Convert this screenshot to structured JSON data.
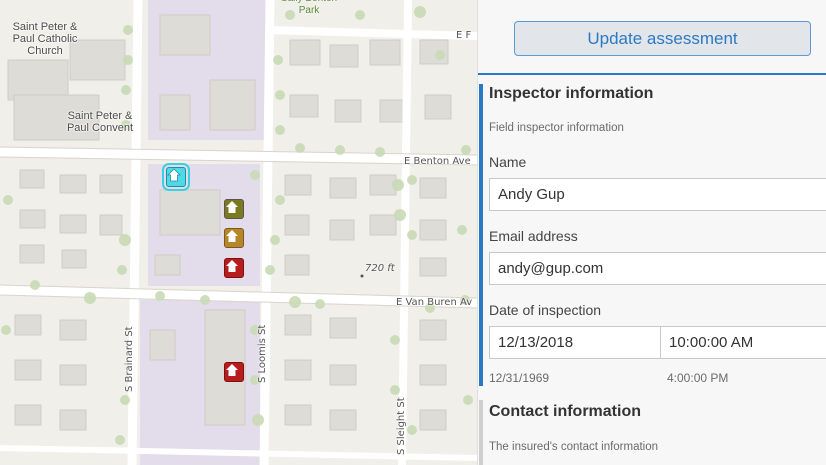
{
  "map": {
    "streets": {
      "e_f": "E F",
      "benton": "E Benton Ave",
      "van_buren": "E Van Buren Av",
      "brainard": "S Brainard St",
      "loomis": "S Loomis St",
      "sleight": "S Sleight St"
    },
    "pois": {
      "church": "Saint Peter & Paul Catholic Church",
      "convent": "Saint Peter & Paul Convent",
      "park": "Sally Benton Park"
    },
    "elevation": "720 ft",
    "markers": [
      {
        "name": "selected-assessment",
        "fill": "#4fd9e8"
      },
      {
        "name": "assessment-olive",
        "fill": "#7a7a1e"
      },
      {
        "name": "assessment-ochre",
        "fill": "#b7862a"
      },
      {
        "name": "assessment-red-1",
        "fill": "#b81d1d"
      },
      {
        "name": "assessment-red-2",
        "fill": "#b81d1d"
      }
    ]
  },
  "panel": {
    "update_label": "Update assessment",
    "inspector": {
      "title": "Inspector information",
      "description": "Field inspector information",
      "name_label": "Name",
      "name_value": "Andy Gup",
      "email_label": "Email address",
      "email_value": "andy@gup.com",
      "date_label": "Date of inspection",
      "date_value": "12/13/2018",
      "time_value": "10:00:00 AM",
      "date_hint": "12/31/1969",
      "time_hint": "4:00:00 PM"
    },
    "contact": {
      "title": "Contact information",
      "description": "The insured's contact information"
    }
  },
  "colors": {
    "accent": "#2b79c2",
    "group_bar_active": "#2b79c2",
    "group_bar_inactive": "#cfcfcf"
  }
}
